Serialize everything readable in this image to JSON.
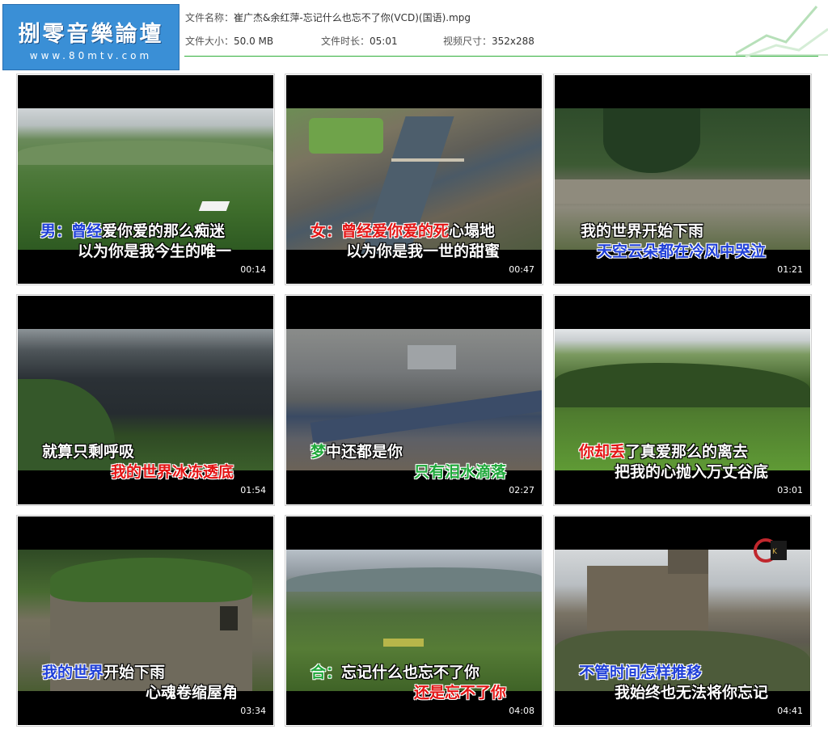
{
  "header": {
    "logo_title": "捌零音樂論壇",
    "logo_site": "www.80mtv.com",
    "file_name_label": "文件名称：",
    "file_name": "崔广杰&余红萍-忘记什么也忘不了你(VCD)(国语).mpg",
    "file_size_label": "文件大小：",
    "file_size": "50.0 MB",
    "duration_label": "文件时长：",
    "duration": "05:01",
    "resolution_label": "视频尺寸：",
    "resolution": "352x288"
  },
  "thumbnails": [
    {
      "time": "00:14",
      "line1": {
        "hl": "男：曾经",
        "rest": "爱你爱的那么痴迷"
      },
      "line2": {
        "hl": "",
        "rest": "以为你是我今生的唯一"
      }
    },
    {
      "time": "00:47",
      "line1": {
        "hl": "女：曾经爱你爱的死",
        "rest": "心塌地"
      },
      "line2": {
        "hl": "",
        "rest": "以为你是我一世的甜蜜"
      }
    },
    {
      "time": "01:21",
      "line1": {
        "hl": "",
        "rest": "我的世界开始下雨"
      },
      "line2": {
        "hl": "天空云朵都在冷风中哭泣",
        "rest": ""
      }
    },
    {
      "time": "01:54",
      "line1": {
        "hl": "",
        "rest": "就算只剩呼吸"
      },
      "line2": {
        "hl": "我的世界冰冻透底",
        "rest": ""
      }
    },
    {
      "time": "02:27",
      "line1": {
        "hl": "梦",
        "rest": "中还都是你"
      },
      "line2": {
        "hl": "只有泪水滴落",
        "rest": ""
      }
    },
    {
      "time": "03:01",
      "line1": {
        "hl": "你却丢",
        "rest": "了真爱那么的离去"
      },
      "line2": {
        "hl": "",
        "rest": "把我的心抛入万丈谷底"
      }
    },
    {
      "time": "03:34",
      "line1": {
        "hl": "我的世界",
        "rest": "开始下雨"
      },
      "line2": {
        "hl": "",
        "rest": "心魂卷缩屋角"
      }
    },
    {
      "time": "04:08",
      "line1": {
        "hl": "合：",
        "rest": "忘记什么也忘不了你"
      },
      "line2": {
        "hl": "还是忘不了你",
        "rest": ""
      }
    },
    {
      "time": "04:41",
      "line1": {
        "hl": "不管时间怎样推移",
        "rest": ""
      },
      "line2": {
        "hl": "",
        "rest": "我始终也无法将你忘记"
      }
    }
  ],
  "colors": {
    "highlight_male": "#1f3fd8",
    "highlight_female": "#e41515",
    "highlight_chorus": "#1fa83a",
    "accent_line": "#2fae3a",
    "logo_bg": "#3a8fd6"
  }
}
